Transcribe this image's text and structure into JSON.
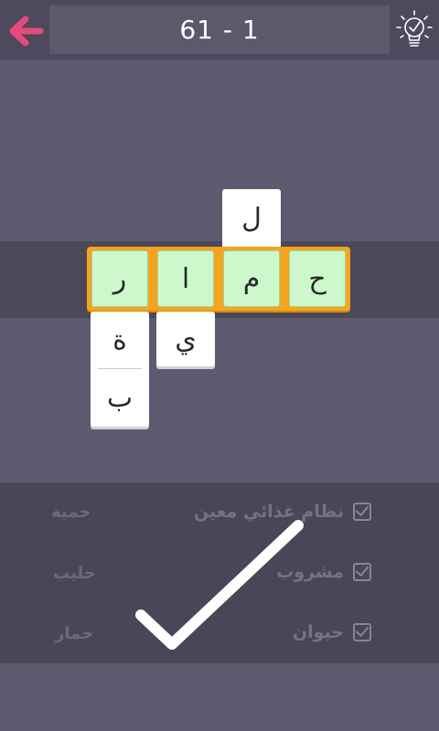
{
  "header": {
    "level": "61 - 1"
  },
  "puzzle": {
    "main_row": [
      "ح",
      "م",
      "ا",
      "ر"
    ],
    "above_letter": "ل",
    "below_alef": "ي",
    "below_ra": [
      "ة",
      "ب"
    ]
  },
  "clues": {
    "found": [
      "نظام غذائي معين",
      "مشروب",
      "حيوان"
    ],
    "answers": [
      "حمية",
      "حليب",
      "حمار"
    ]
  },
  "colors": {
    "accent": "#e34b7a",
    "tile_green": "#ccf8cc",
    "word_bar": "#f5a51d"
  }
}
